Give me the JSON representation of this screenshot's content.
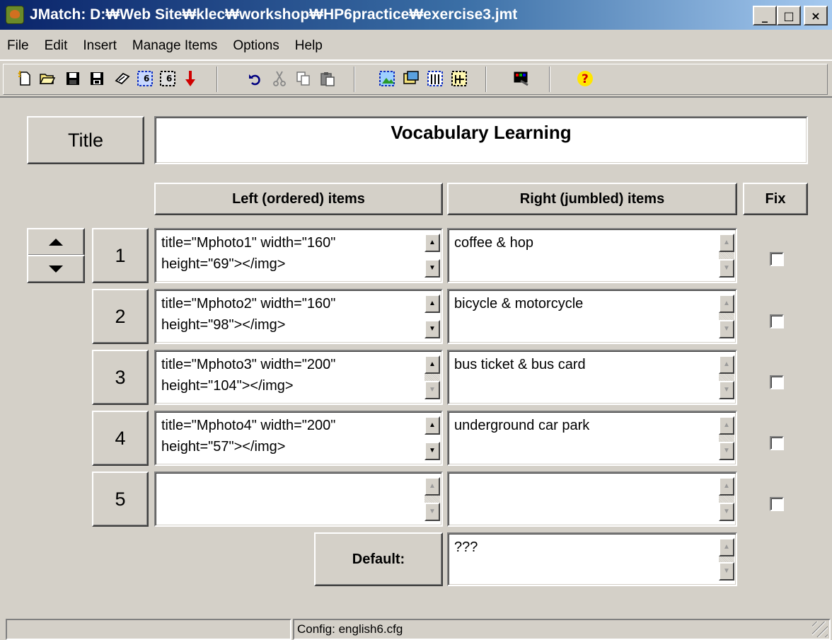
{
  "window": {
    "title": "JMatch: D:₩Web Site₩klec₩workshop₩HP6practice₩exercise3.jmt",
    "controls": {
      "minimize": "_",
      "maximize": "□",
      "close": "×"
    }
  },
  "menu": [
    "File",
    "Edit",
    "Insert",
    "Manage Items",
    "Options",
    "Help"
  ],
  "toolbar": {
    "icons": [
      {
        "name": "new-file-icon",
        "glyph": "🗒"
      },
      {
        "name": "open-folder-icon",
        "glyph": "📂"
      },
      {
        "name": "save-icon",
        "glyph": "💾"
      },
      {
        "name": "save-as-icon",
        "glyph": "💾"
      },
      {
        "name": "view-in-browser-icon",
        "glyph": "✧"
      },
      {
        "name": "export-html-6-icon",
        "glyph": "▦"
      },
      {
        "name": "export-html-6-alt-icon",
        "glyph": "▦"
      },
      {
        "name": "upload-red-arrow-icon",
        "glyph": "⬇"
      },
      {
        "name": "undo-icon",
        "glyph": "↶"
      },
      {
        "name": "cut-icon",
        "glyph": "✂"
      },
      {
        "name": "copy-icon",
        "glyph": "⧉"
      },
      {
        "name": "paste-icon",
        "glyph": "📋"
      },
      {
        "name": "insert-picture-icon",
        "glyph": "▣"
      },
      {
        "name": "insert-link-icon",
        "glyph": "❐"
      },
      {
        "name": "insert-table-icon",
        "glyph": "▤"
      },
      {
        "name": "insert-media-icon",
        "glyph": "▥"
      },
      {
        "name": "config-screen-icon",
        "glyph": "▨"
      },
      {
        "name": "help-icon",
        "glyph": "?"
      }
    ]
  },
  "exercise": {
    "title_label": "Title",
    "title_value": "Vocabulary Learning",
    "left_header": "Left (ordered) items",
    "right_header": "Right (jumbled) items",
    "fix_header": "Fix",
    "items": [
      {
        "number": "1",
        "left": "title=\"Mphoto1\" width=\"160\"\nheight=\"69\"></img>",
        "right": "coffee & hop",
        "fixed": false
      },
      {
        "number": "2",
        "left": "title=\"Mphoto2\" width=\"160\"\nheight=\"98\"></img>",
        "right": "bicycle & motorcycle",
        "fixed": false
      },
      {
        "number": "3",
        "left": "title=\"Mphoto3\" width=\"200\"\nheight=\"104\"></img>",
        "right": "bus ticket & bus card",
        "fixed": false
      },
      {
        "number": "4",
        "left": "title=\"Mphoto4\" width=\"200\"\nheight=\"57\"></img>",
        "right": "underground car park",
        "fixed": false
      },
      {
        "number": "5",
        "left": "",
        "right": "",
        "fixed": false
      }
    ],
    "default_label": "Default:",
    "default_value": "???"
  },
  "status": {
    "left": "",
    "config": "Config: english6.cfg"
  }
}
